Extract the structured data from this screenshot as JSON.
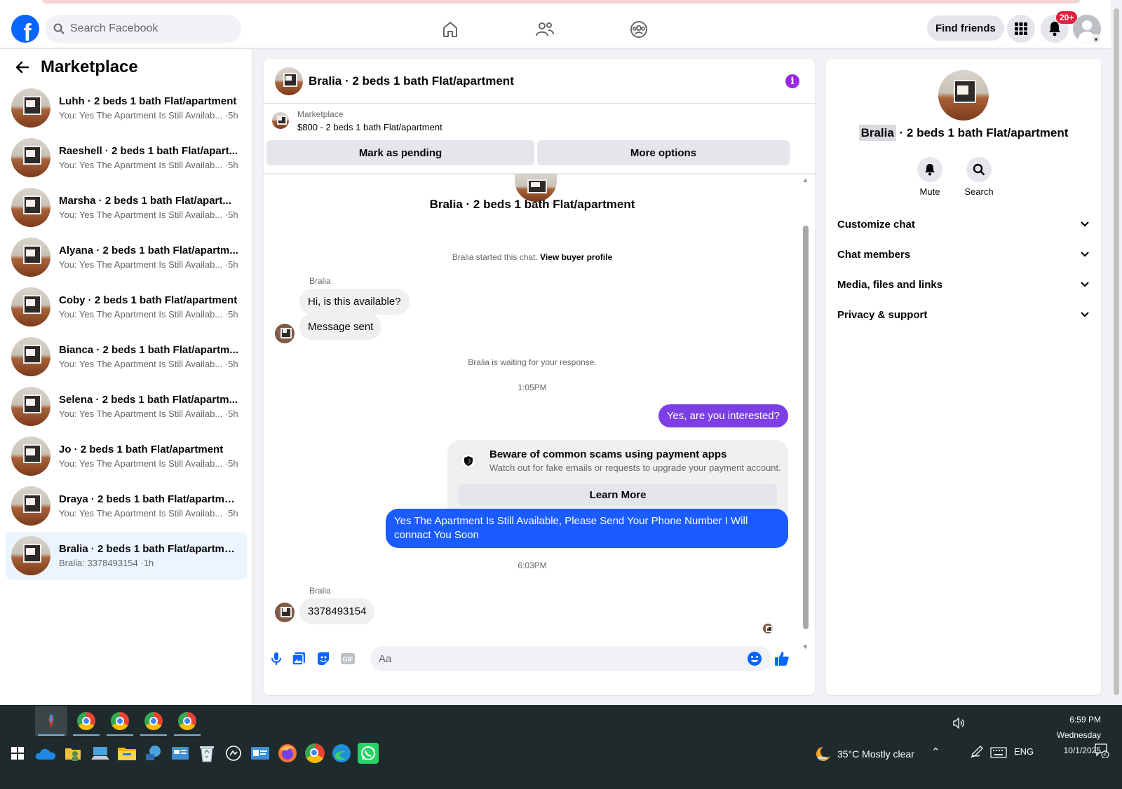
{
  "header": {
    "search_placeholder": "Search Facebook",
    "find_friends": "Find friends",
    "notifications_badge": "20+"
  },
  "sidebar": {
    "title": "Marketplace",
    "conversations": [
      {
        "name": "Luhh · 2 beds 1 bath Flat/apartment",
        "snippet": "You: Yes The Apartment Is Still Availab... ·5h"
      },
      {
        "name": "Raeshell · 2 beds 1 bath Flat/apart...",
        "snippet": "You: Yes The Apartment Is Still Availab... ·5h"
      },
      {
        "name": "Marsha · 2 beds 1 bath Flat/apart...",
        "snippet": "You: Yes The Apartment Is Still Availab... ·5h"
      },
      {
        "name": "Alyana · 2 beds 1 bath Flat/apartm...",
        "snippet": "You: Yes The Apartment Is Still Availab... ·5h"
      },
      {
        "name": "Coby · 2 beds 1 bath Flat/apartment",
        "snippet": "You: Yes The Apartment Is Still Availab... ·5h"
      },
      {
        "name": "Bianca · 2 beds 1 bath Flat/apartm...",
        "snippet": "You: Yes The Apartment Is Still Availab... ·5h"
      },
      {
        "name": "Selena · 2 beds 1 bath Flat/apartm...",
        "snippet": "You: Yes The Apartment Is Still Availab... ·5h"
      },
      {
        "name": "Jo · 2 beds 1 bath Flat/apartment",
        "snippet": "You: Yes The Apartment Is Still Availab... ·5h"
      },
      {
        "name": "Draya · 2 beds 1 bath Flat/apartment",
        "snippet": "You: Yes The Apartment Is Still Availab... ·5h"
      },
      {
        "name": "Bralia · 2 beds 1 bath Flat/apartment",
        "snippet": "Bralia: 3378493154 ·1h"
      }
    ]
  },
  "chat": {
    "title": "Bralia · 2 beds 1 bath Flat/apartment",
    "marketplace_label": "Marketplace",
    "listing": "$800 - 2 beds 1 bath Flat/apartment",
    "mark_pending": "Mark as pending",
    "more_options": "More options",
    "intro_title": "Bralia · 2 beds 1 bath Flat/apartment",
    "started_text": "Bralia started this chat.",
    "view_buyer_profile": "View buyer profile",
    "sender_name": "Bralia",
    "msg1": "Hi, is this available?",
    "msg2": "Message sent",
    "waiting_text": "Bralia is waiting for your response.",
    "time1": "1:05PM",
    "out1": "Yes, are you interested?",
    "scam_title": "Beware of common scams using payment apps",
    "scam_body": "Watch out for fake emails or requests to upgrade your payment account.",
    "learn_more": "Learn More",
    "out2": "Yes The Apartment Is Still Available, Please Send Your Phone Number I Will connact You Soon",
    "time2": "6:03PM",
    "sender_name2": "Bralia",
    "msg3": "3378493154",
    "composer_placeholder": "Aa",
    "colors": {
      "accent": "#0866ff",
      "bubble_purple": "#7b3fe4",
      "bubble_blue": "#1a5cff"
    }
  },
  "right_panel": {
    "name_highlight": "Bralia",
    "name_rest": " · 2 beds 1 bath Flat/apartment",
    "mute": "Mute",
    "search": "Search",
    "sections": [
      "Customize chat",
      "Chat members",
      "Media, files and links",
      "Privacy & support"
    ]
  },
  "taskbar": {
    "weather": "35°C  Mostly clear",
    "lang": "ENG",
    "time": "6:59 PM",
    "day": "Wednesday",
    "date": "10/1/2025",
    "notif_count": "2"
  }
}
